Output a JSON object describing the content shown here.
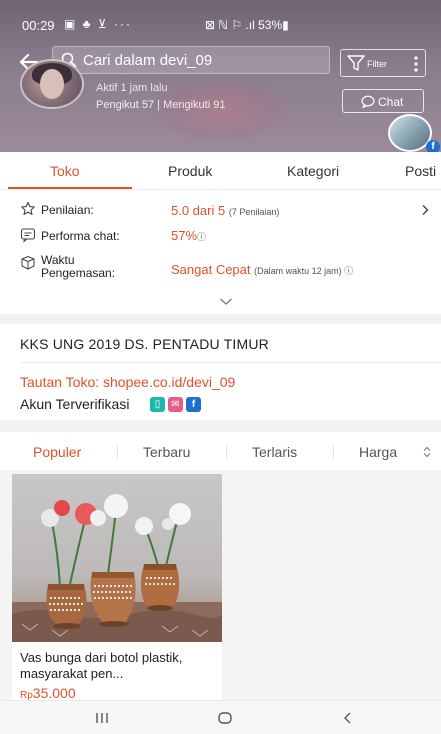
{
  "status_bar": {
    "time": "00:29",
    "notification_icons": "▣ ♣ ⊻ ···",
    "right": "⊠ ℕ ⚐ .ıl 53%▮"
  },
  "header": {
    "search_placeholder": "Cari dalam devi_09",
    "filter_label": "Filter",
    "active_status": "Aktif 1 jam lalu",
    "followers": "Pengikut 57 | Mengikuti 91",
    "chat_label": "Chat"
  },
  "tabs": [
    {
      "label": "Toko"
    },
    {
      "label": "Produk"
    },
    {
      "label": "Kategori"
    },
    {
      "label": "Posti"
    }
  ],
  "stats": {
    "rating_label": "Penilaian:",
    "rating_value": "5.0 dari 5",
    "rating_count": "(7 Penilaian)",
    "chat_label": "Performa chat:",
    "chat_value": "57%",
    "chat_info": "ⓘ",
    "pack_label_1": "Waktu",
    "pack_label_2": "Pengemasan:",
    "pack_value": "Sangat Cepat",
    "pack_detail": "(Dalam waktu 12 jam) ⓘ"
  },
  "shop": {
    "name": "KKS UNG 2019 DS. PENTADU TIMUR",
    "link": "Tautan Toko: shopee.co.id/devi_09",
    "verified": "Akun Terverifikasi",
    "badges": [
      {
        "glyph": "▯",
        "color": "#1cb8a3"
      },
      {
        "glyph": "✉",
        "color": "#e85c8a"
      },
      {
        "glyph": "f",
        "color": "#1f6fd0"
      }
    ]
  },
  "sort": [
    {
      "label": "Populer"
    },
    {
      "label": "Terbaru"
    },
    {
      "label": "Terlaris"
    },
    {
      "label": "Harga"
    }
  ],
  "products": [
    {
      "title": "Vas bunga dari botol plastik, masyarakat pen...",
      "currency": "Rp",
      "price": "35.000"
    }
  ],
  "nav": {
    "recent": "|||",
    "home": "○",
    "back": "<"
  },
  "colors": {
    "accent": "#e0502b"
  }
}
